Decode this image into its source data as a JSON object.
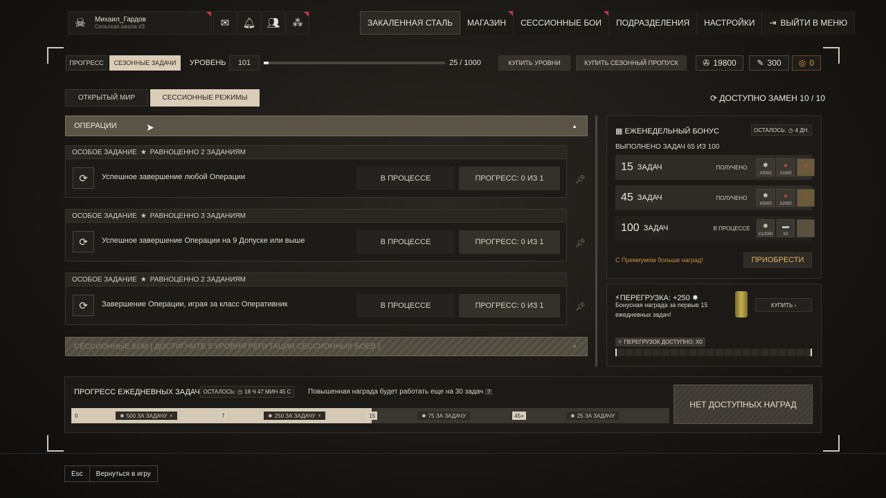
{
  "profile": {
    "name": "Михаил_Гардов",
    "subtitle": "Сельская школа #3"
  },
  "nav": [
    "Закаленная сталь",
    "Магазин",
    "Сессионные бои",
    "Подразделения",
    "Настройки",
    "Выйти в меню"
  ],
  "tabs_top": {
    "progress": "Прогресс",
    "seasonal": "Сезонные задачи"
  },
  "level": {
    "label": "Уровень",
    "value": "101",
    "progress_text": "25 / 1000",
    "fraction": 0.025
  },
  "buy_levels": "Купить уровни",
  "buy_pass": "Купить сезонный пропуск",
  "currency": {
    "credits": "19800",
    "feathers": "300",
    "coins": "0"
  },
  "mode_tabs": {
    "open_world": "Открытый мир",
    "session": "Сессионные режимы"
  },
  "replacements": "Доступно замен 10 / 10",
  "section_operations": "Операции",
  "tasks": [
    {
      "header": "Особое задание",
      "equiv": "Равноценно 2 заданиям",
      "desc": "Успешное завершение любой Операции",
      "status": "В процессе",
      "progress": "Прогресс: 0 из 1"
    },
    {
      "header": "Особое задание",
      "equiv": "Равноценно 3 заданиям",
      "desc": "Успешное завершение Операции на 9 Допуске или выше",
      "status": "В процессе",
      "progress": "Прогресс: 0 из 1"
    },
    {
      "header": "Особое задание",
      "equiv": "Равноценно 2 заданиям",
      "desc": "Завершение Операции, играя за класс Оперативник",
      "status": "В процессе",
      "progress": "Прогресс: 0 из 1"
    }
  ],
  "section_session_locked": "Сессионные бои [ Достигните 5 уровня репутации сессионных боев ]",
  "weekly": {
    "title": "Еженедельный бонус",
    "remaining": "Осталось:",
    "remaining_time": "4 дн.",
    "done": "Выполнено задач 65 из 100",
    "rows": [
      {
        "num": "15",
        "label": "задач",
        "status": "Получено",
        "r1": "x3000",
        "r2": "x1000"
      },
      {
        "num": "45",
        "label": "задач",
        "status": "Получено",
        "r1": "x5000",
        "r2": "x2000"
      },
      {
        "num": "100",
        "label": "задач",
        "status": "В процессе",
        "r1": "x12000",
        "r2": "x2"
      }
    ],
    "premium_note": "С Премиумом больше наград!",
    "buy": "Приобрести"
  },
  "overload": {
    "title": "Перегрузка: +250",
    "desc1": "Бонусная награда за первые 15",
    "desc2": "ежедневных задач!",
    "buy": "Купить",
    "available": "Перегрузок доступно: x0"
  },
  "daily": {
    "title": "Прогресс ежедневных задач",
    "remaining": "Осталось:",
    "remaining_time": "18 ч 47 мин 45 с",
    "note": "Повышенная награда будет работать еще на 30 задач",
    "marks": [
      "0",
      "7",
      "15",
      "45+"
    ],
    "rewards": [
      "500 за задачу",
      "250 за задачу",
      "75 за задачу",
      "25 за задачу"
    ],
    "no_rewards": "Нет доступных наград"
  },
  "bottom": {
    "esc": "Esc",
    "back": "Вернуться в игру"
  }
}
